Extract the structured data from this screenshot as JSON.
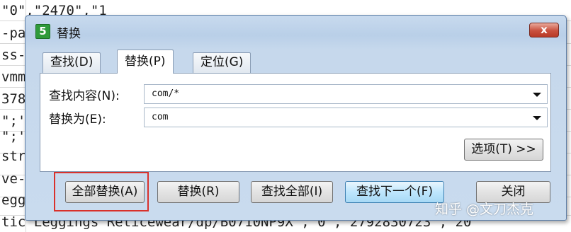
{
  "sheet": {
    "lines": [
      "\"0\",\"2470\",\"1",
      "-pa",
      "ss-",
      "vmm",
      "378",
      "\";'",
      "\";'",
      "stri",
      "ve-",
      "eggi",
      "tic Leggings Reticewear/dp/B0710NP9X\",\"0\",\"2792830723\",\"20"
    ]
  },
  "dialog": {
    "app_icon_letter": "5",
    "title": "替换",
    "close_symbol": "x",
    "tabs": [
      {
        "label": "查找(D)",
        "active": false
      },
      {
        "label": "替换(P)",
        "active": true
      },
      {
        "label": "定位(G)",
        "active": false
      }
    ],
    "find_label": "查找内容(N):",
    "find_value": "com/*",
    "replace_label": "替换为(E):",
    "replace_value": "com",
    "options_label": "选项(T) >>",
    "buttons": {
      "replace_all": "全部替换(A)",
      "replace": "替换(R)",
      "find_all": "查找全部(I)",
      "find_next": "查找下一个(F)",
      "close": "关闭"
    }
  },
  "watermark": "知乎 @文刀杰克",
  "colors": {
    "highlight": "#d9312b",
    "title_gradient_top": "#c8daee",
    "close_red": "#c9503d"
  }
}
